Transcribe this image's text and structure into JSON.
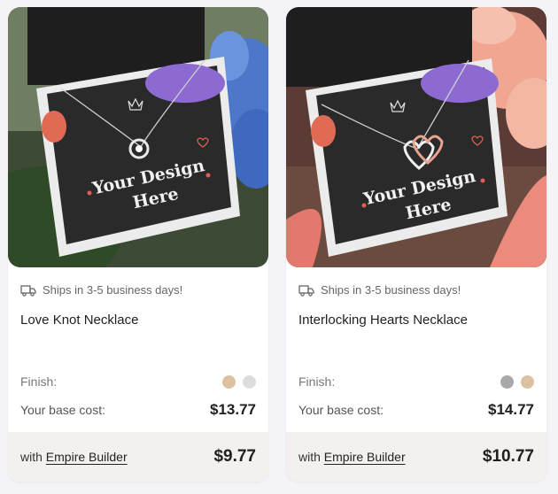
{
  "products": [
    {
      "title": "Love Knot Necklace",
      "shipping": "Ships in 3-5 business days!",
      "card_text_line1": "Your Design",
      "card_text_line2": "Here",
      "finish_label": "Finish:",
      "finish_colors": [
        "#dcc2a2",
        "#dddddd"
      ],
      "base_cost_label": "Your base cost:",
      "base_cost": "$13.77",
      "with_label": "with",
      "program_link": "Empire Builder",
      "program_price": "$9.77",
      "colors": {
        "bg": "#3e4a37",
        "accent": "#a97fd8"
      }
    },
    {
      "title": "Interlocking Hearts Necklace",
      "shipping": "Ships in 3-5 business days!",
      "card_text_line1": "Your Design",
      "card_text_line2": "Here",
      "finish_label": "Finish:",
      "finish_colors": [
        "#a9a9ab",
        "#dcc2a2"
      ],
      "base_cost_label": "Your base cost:",
      "base_cost": "$14.77",
      "with_label": "with",
      "program_link": "Empire Builder",
      "program_price": "$10.77",
      "colors": {
        "bg": "#5a3a34",
        "accent": "#a97fd8"
      }
    }
  ]
}
